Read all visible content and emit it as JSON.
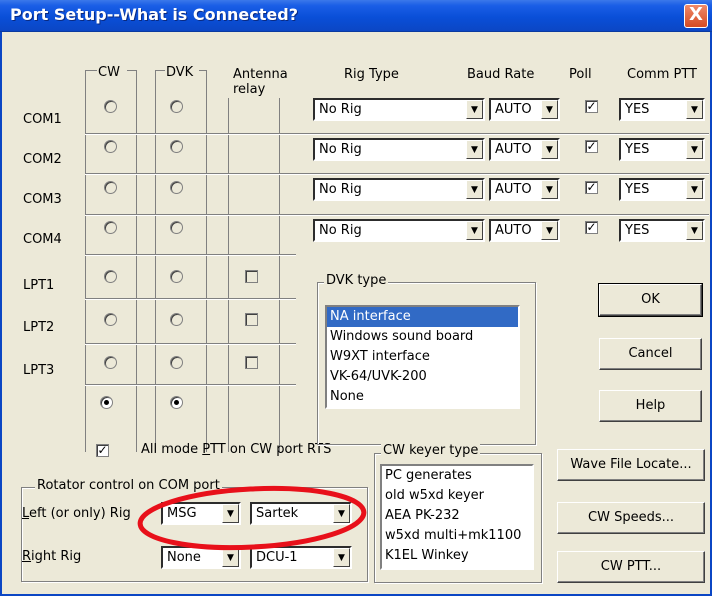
{
  "window": {
    "title": "Port Setup--What is Connected?",
    "close_glyph": "X"
  },
  "headers": {
    "cw": "CW",
    "dvk": "DVK",
    "antenna_relay": "Antenna relay",
    "rig_type": "Rig Type",
    "baud_rate": "Baud Rate",
    "poll": "Poll",
    "comm_ptt": "Comm PTT"
  },
  "com_ports": [
    {
      "label": "COM1",
      "rig": "No Rig",
      "baud": "AUTO",
      "poll": true,
      "ptt": "YES"
    },
    {
      "label": "COM2",
      "rig": "No Rig",
      "baud": "AUTO",
      "poll": true,
      "ptt": "YES"
    },
    {
      "label": "COM3",
      "rig": "No Rig",
      "baud": "AUTO",
      "poll": true,
      "ptt": "YES"
    },
    {
      "label": "COM4",
      "rig": "No Rig",
      "baud": "AUTO",
      "poll": true,
      "ptt": "YES"
    }
  ],
  "lpt_ports": [
    {
      "label": "LPT1"
    },
    {
      "label": "LPT2"
    },
    {
      "label": "LPT3"
    }
  ],
  "none_row": {
    "cw_selected": true,
    "dvk_selected": true
  },
  "dvk_type": {
    "title": "DVK type",
    "items": [
      "NA interface",
      "Windows sound board",
      "W9XT interface",
      "VK-64/UVK-200",
      "None"
    ],
    "selected_index": 0
  },
  "cw_keyer_type": {
    "title": "CW keyer type",
    "items": [
      "PC generates",
      "old w5xd keyer",
      "AEA PK-232",
      "w5xd multi+mk1100",
      "K1EL Winkey"
    ]
  },
  "all_mode_ptt": {
    "checked": true,
    "label_pre": "All mode ",
    "label_u": "P",
    "label_post": "TT on CW port RTS"
  },
  "rotator": {
    "title": "Rotator control on COM port",
    "left_label_u": "L",
    "left_label_rest": "eft (or only) Rig",
    "left_port": "MSG",
    "left_type": "Sartek",
    "right_label_u": "R",
    "right_label_rest": "ight Rig",
    "right_port": "None",
    "right_type": "DCU-1"
  },
  "buttons": {
    "ok": "OK",
    "cancel": "Cancel",
    "help": "Help",
    "wave_file_locate": "Wave File Locate...",
    "cw_speeds": "CW Speeds...",
    "cw_ptt": "CW PTT..."
  },
  "colors": {
    "titlebar": "#0b46c4",
    "dialog": "#ece9d8",
    "highlight": "#316ac5",
    "annotation": "#e8101a"
  }
}
